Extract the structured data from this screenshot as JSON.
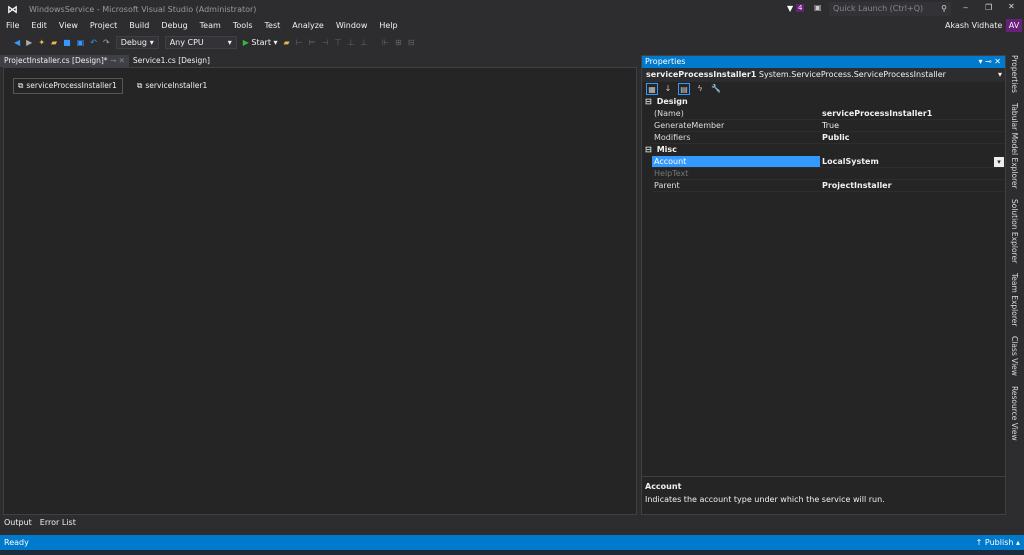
{
  "title": "WindowsService - Microsoft Visual Studio (Administrator)",
  "notifications": "4",
  "quick_launch_placeholder": "Quick Launch (Ctrl+Q)",
  "user": {
    "name": "Akash Vidhate",
    "initials": "AV"
  },
  "menu": [
    "File",
    "Edit",
    "View",
    "Project",
    "Build",
    "Debug",
    "Team",
    "Tools",
    "Test",
    "Analyze",
    "Window",
    "Help"
  ],
  "toolbar": {
    "config": "Debug",
    "platform": "Any CPU",
    "start": "Start"
  },
  "tabs": [
    {
      "label": "ProjectInstaller.cs [Design]*"
    },
    {
      "label": "Service1.cs [Design]"
    }
  ],
  "components": [
    "serviceProcessInstaller1",
    "serviceInstaller1"
  ],
  "properties": {
    "title": "Properties",
    "object_name": "serviceProcessInstaller1",
    "object_type": "System.ServiceProcess.ServiceProcessInstaller",
    "categories": [
      {
        "name": "Design",
        "rows": [
          {
            "name": "(Name)",
            "value": "serviceProcessInstaller1"
          },
          {
            "name": "GenerateMember",
            "value": "True"
          },
          {
            "name": "Modifiers",
            "value": "Public"
          }
        ]
      },
      {
        "name": "Misc",
        "rows": [
          {
            "name": "Account",
            "value": "LocalSystem"
          },
          {
            "name": "HelpText",
            "value": ""
          },
          {
            "name": "Parent",
            "value": "ProjectInstaller"
          }
        ]
      }
    ],
    "desc_title": "Account",
    "desc_text": "Indicates the account type under which the service will run."
  },
  "side_tabs": [
    "Properties",
    "Tabular Model Explorer",
    "Solution Explorer",
    "Team Explorer",
    "Class View",
    "Resource View"
  ],
  "bottom_tabs": [
    "Output",
    "Error List"
  ],
  "status": {
    "text": "Ready",
    "publish": "Publish"
  }
}
